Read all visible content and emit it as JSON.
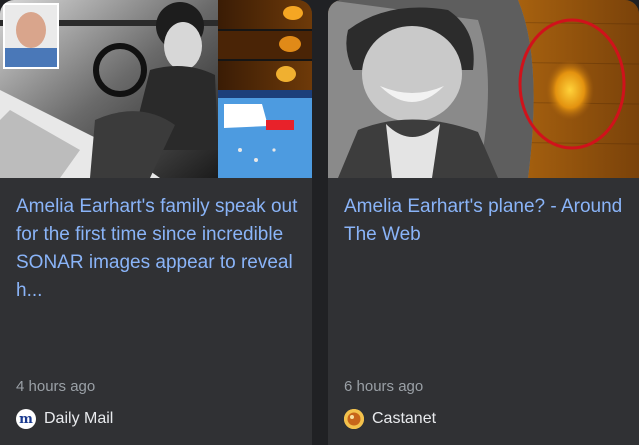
{
  "cards": [
    {
      "headline": "Amelia Earhart's family speak out for the first time since incredible SONAR images appear to reveal h...",
      "time": "4 hours ago",
      "source": "Daily Mail",
      "source_icon_glyph": "m",
      "thumbnail": "photo-collage-icon"
    },
    {
      "headline": "Amelia Earhart's plane? - Around The Web",
      "time": "6 hours ago",
      "source": "Castanet",
      "thumbnail": "sonar-photo-icon"
    }
  ],
  "colors": {
    "background": "#202124",
    "card": "#303134",
    "headline": "#8ab4f8",
    "meta": "#9aa0a6",
    "source": "#e8eaed",
    "sonar_circle": "#d0121b"
  }
}
